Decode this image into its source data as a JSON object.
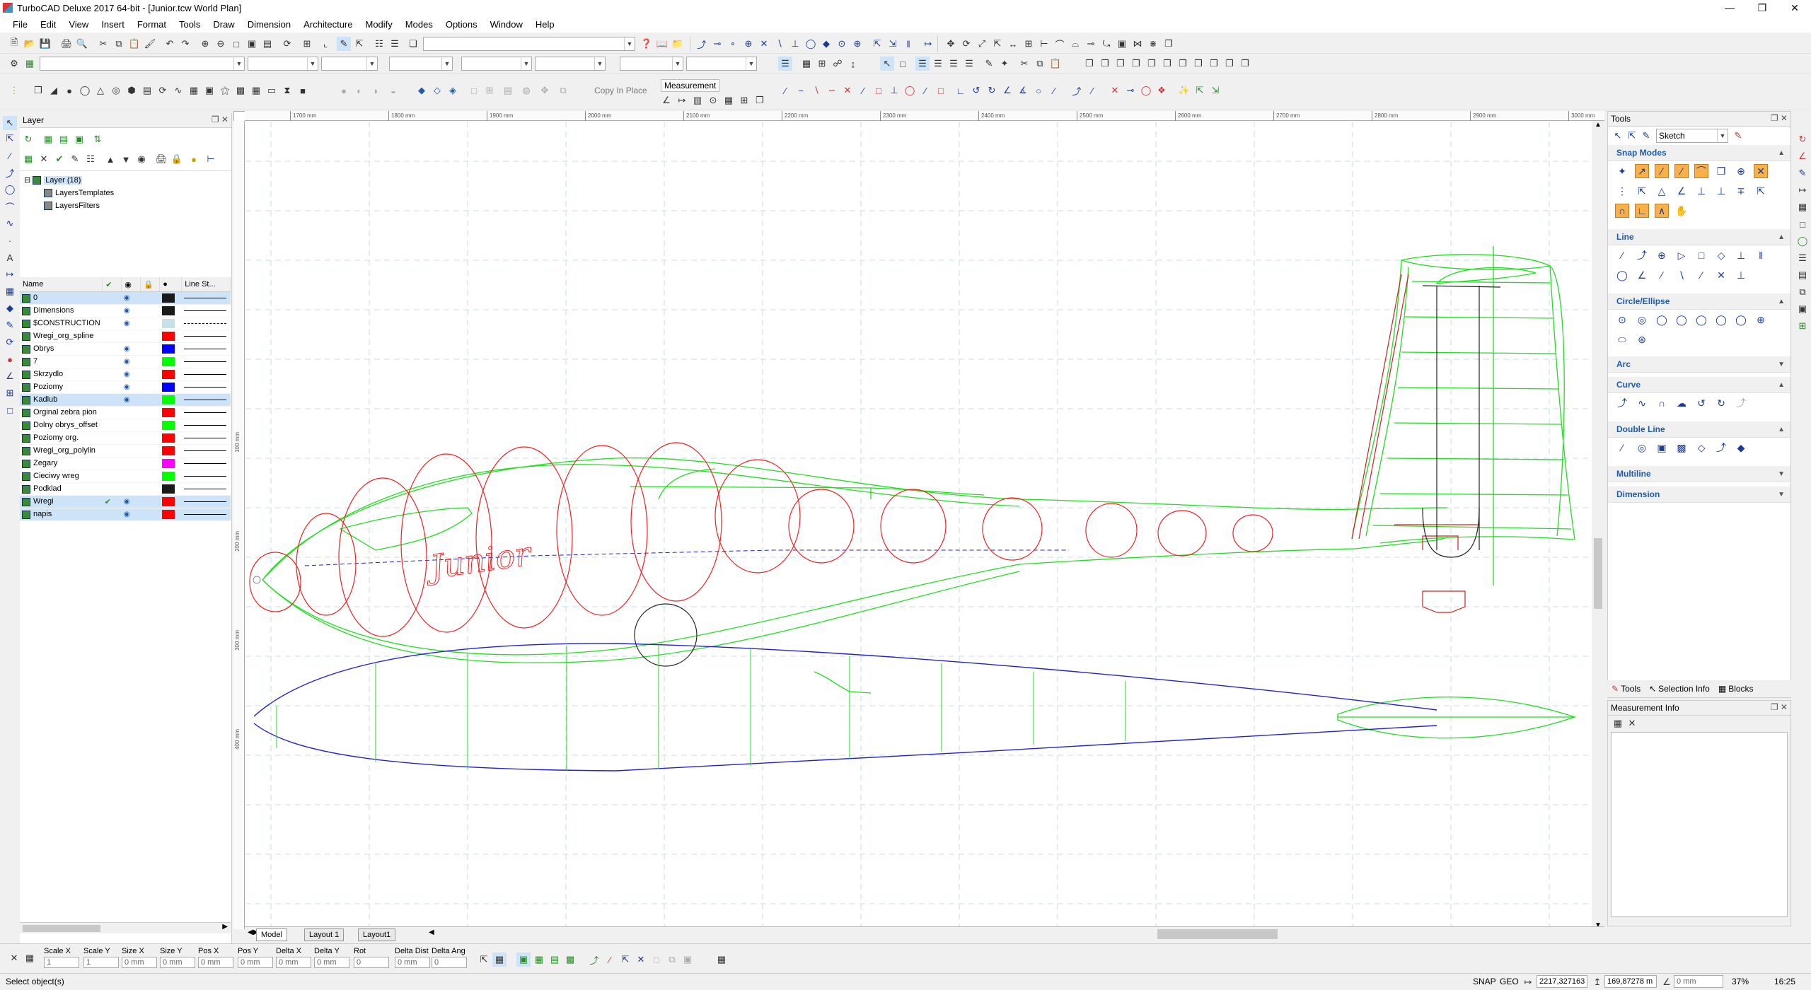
{
  "window": {
    "title": "TurboCAD Deluxe 2017 64-bit - [Junior.tcw World Plan]"
  },
  "menu": [
    "File",
    "Edit",
    "View",
    "Insert",
    "Format",
    "Tools",
    "Draw",
    "Dimension",
    "Architecture",
    "Modify",
    "Modes",
    "Options",
    "Window",
    "Help"
  ],
  "toolbar": {
    "copy_in_place": "Copy In Place",
    "measurement_group": "Measurement"
  },
  "layer_panel": {
    "title": "Layer",
    "tree": [
      "Layer (18)",
      "LayersTemplates",
      "LayersFilters"
    ],
    "columns": [
      "Name",
      "Line St..."
    ],
    "rows": [
      {
        "name": "0",
        "color": "#1a1a1a",
        "selected": true,
        "visible": true,
        "active": false,
        "style": "solid"
      },
      {
        "name": "Dimensions",
        "color": "#1a1a1a",
        "selected": false,
        "visible": true,
        "active": false,
        "style": "solid"
      },
      {
        "name": "$CONSTRUCTION",
        "color": "#c8e0e8",
        "selected": false,
        "visible": true,
        "active": false,
        "style": "dash"
      },
      {
        "name": "Wregi_org_spline",
        "color": "#ff0000",
        "selected": false,
        "visible": false,
        "active": false,
        "style": "solid"
      },
      {
        "name": "Obrys",
        "color": "#0000ff",
        "selected": false,
        "visible": true,
        "active": false,
        "style": "solid"
      },
      {
        "name": "7",
        "color": "#00ff00",
        "selected": false,
        "visible": true,
        "active": false,
        "style": "solid"
      },
      {
        "name": "Skrzydlo",
        "color": "#ff0000",
        "selected": false,
        "visible": true,
        "active": false,
        "style": "solid"
      },
      {
        "name": "Poziomy",
        "color": "#0000ff",
        "selected": false,
        "visible": true,
        "active": false,
        "style": "solid"
      },
      {
        "name": "Kadlub",
        "color": "#00ff00",
        "selected": true,
        "visible": true,
        "active": false,
        "style": "solid"
      },
      {
        "name": "Orginal zebra pion",
        "color": "#ff0000",
        "selected": false,
        "visible": false,
        "active": false,
        "style": "solid"
      },
      {
        "name": "Dolny obrys_offset",
        "color": "#00ff00",
        "selected": false,
        "visible": false,
        "active": false,
        "style": "solid"
      },
      {
        "name": "Poziomy org.",
        "color": "#ff0000",
        "selected": false,
        "visible": false,
        "active": false,
        "style": "solid"
      },
      {
        "name": "Wregi_org_polylin",
        "color": "#ff0000",
        "selected": false,
        "visible": false,
        "active": false,
        "style": "solid"
      },
      {
        "name": "Zegary",
        "color": "#ff00ff",
        "selected": false,
        "visible": false,
        "active": false,
        "style": "solid"
      },
      {
        "name": "Cieciwy wreg",
        "color": "#00ff00",
        "selected": false,
        "visible": false,
        "active": false,
        "style": "solid"
      },
      {
        "name": "Podklad",
        "color": "#1a1a1a",
        "selected": false,
        "visible": false,
        "active": false,
        "style": "solid"
      },
      {
        "name": "Wregi",
        "color": "#ff0000",
        "selected": true,
        "visible": true,
        "active": true,
        "style": "solid"
      },
      {
        "name": "napis",
        "color": "#ff0000",
        "selected": true,
        "visible": true,
        "active": false,
        "style": "solid"
      }
    ]
  },
  "ruler": {
    "top": [
      "1700 mm",
      "1800 mm",
      "1900 mm",
      "2000 mm",
      "2100 mm",
      "2200 mm",
      "2300 mm",
      "2400 mm",
      "2500 mm",
      "2600 mm",
      "2700 mm",
      "2800 mm",
      "2900 mm",
      "3000 mm"
    ],
    "left": [
      "100 mm",
      "200 mm",
      "300 mm",
      "400 mm"
    ]
  },
  "drawing": {
    "text": "Junior"
  },
  "layout_tabs": [
    "Model",
    "Layout 1",
    "Layout1"
  ],
  "tools_panel": {
    "title": "Tools",
    "mode": "Sketch",
    "sections": [
      "Snap Modes",
      "Line",
      "Circle/Ellipse",
      "Arc",
      "Curve",
      "Double Line",
      "Multiline",
      "Dimension"
    ]
  },
  "right_tabs": [
    "Tools",
    "Selection Info",
    "Blocks"
  ],
  "measurement_info": {
    "title": "Measurement Info"
  },
  "coord_fields": [
    {
      "label": "Scale X",
      "value": "1"
    },
    {
      "label": "Scale Y",
      "value": "1"
    },
    {
      "label": "Size X",
      "value": "0 mm"
    },
    {
      "label": "Size Y",
      "value": "0 mm"
    },
    {
      "label": "Pos X",
      "value": "0 mm"
    },
    {
      "label": "Pos Y",
      "value": "0 mm"
    },
    {
      "label": "Delta X",
      "value": "0 mm"
    },
    {
      "label": "Delta Y",
      "value": "0 mm"
    },
    {
      "label": "Rot",
      "value": "0"
    },
    {
      "label": "Delta Dist",
      "value": "0 mm"
    },
    {
      "label": "Delta Ang",
      "value": "0"
    }
  ],
  "status": {
    "message": "Select object(s)",
    "snap": "SNAP",
    "geo": "GEO",
    "coord_x": "2217,327163",
    "coord_y": "169,87278 m",
    "dist": "0 mm",
    "zoom": "37%",
    "time": "16:25"
  },
  "colors": {
    "fuselage": "#22dd22",
    "frames": "#ee2222",
    "wing": "#2222cc",
    "accent": "#f8b04a"
  }
}
